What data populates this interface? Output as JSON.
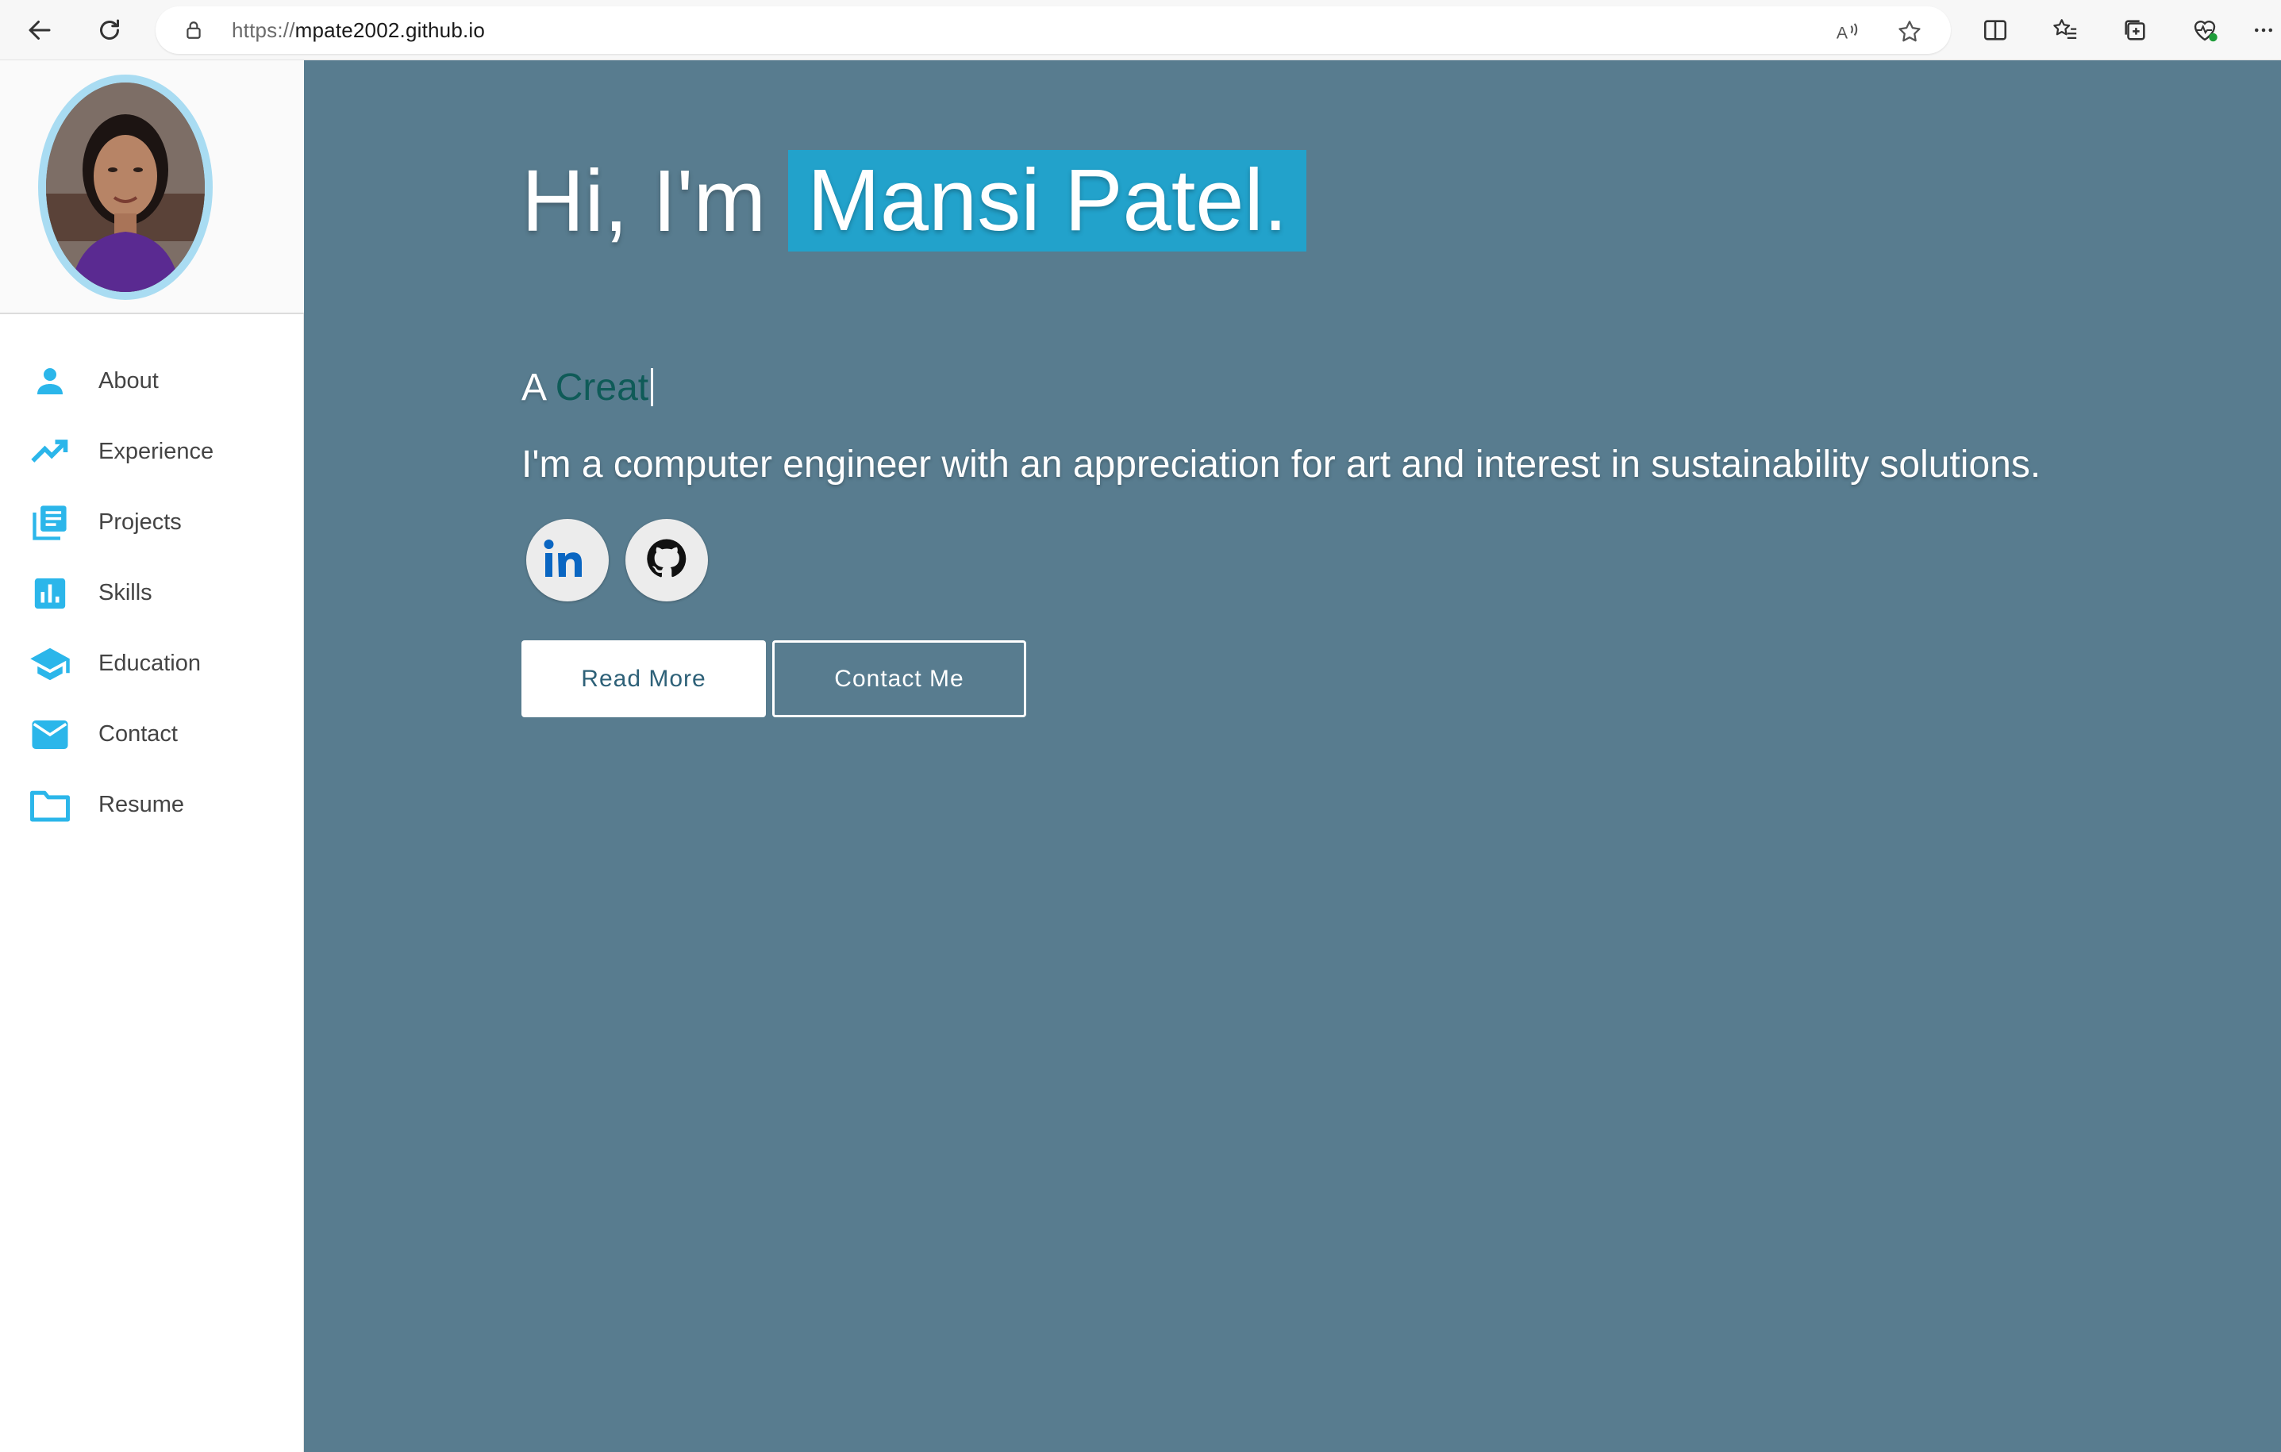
{
  "browser": {
    "url_protocol": "https://",
    "url_host": "mpate2002.github.io",
    "icons": {
      "back": "back-arrow-icon",
      "refresh": "refresh-icon",
      "lock": "lock-icon",
      "read_aloud": "read-aloud-icon",
      "favorite": "star-icon",
      "split_screen": "split-screen-icon",
      "favorites": "favorites-list-icon",
      "collections": "collections-icon",
      "performance": "browser-essentials-icon",
      "more": "more-icon"
    }
  },
  "sidebar": {
    "avatar_alt": "Profile photo",
    "items": [
      {
        "label": "About",
        "icon": "person-icon"
      },
      {
        "label": "Experience",
        "icon": "trending-up-icon"
      },
      {
        "label": "Projects",
        "icon": "library-books-icon"
      },
      {
        "label": "Skills",
        "icon": "bar-chart-icon"
      },
      {
        "label": "Education",
        "icon": "graduation-cap-icon"
      },
      {
        "label": "Contact",
        "icon": "mail-icon"
      },
      {
        "label": "Resume",
        "icon": "folder-icon"
      }
    ]
  },
  "hero": {
    "greeting": "Hi, I'm",
    "name": "Mansi Patel.",
    "typed_prefix": "A",
    "typed_text": "Creat",
    "tagline": "I'm a computer engineer with an appreciation for art and interest in sustainability solutions.",
    "social": [
      {
        "name": "LinkedIn",
        "icon": "linkedin-icon"
      },
      {
        "name": "GitHub",
        "icon": "github-icon"
      }
    ],
    "read_more_label": "Read More",
    "contact_label": "Contact Me"
  },
  "colors": {
    "hero_bg": "#587c8f",
    "name_highlight": "#22a2cb",
    "sidebar_icon": "#2bb6ea",
    "typed_text": "#0f5b58"
  }
}
